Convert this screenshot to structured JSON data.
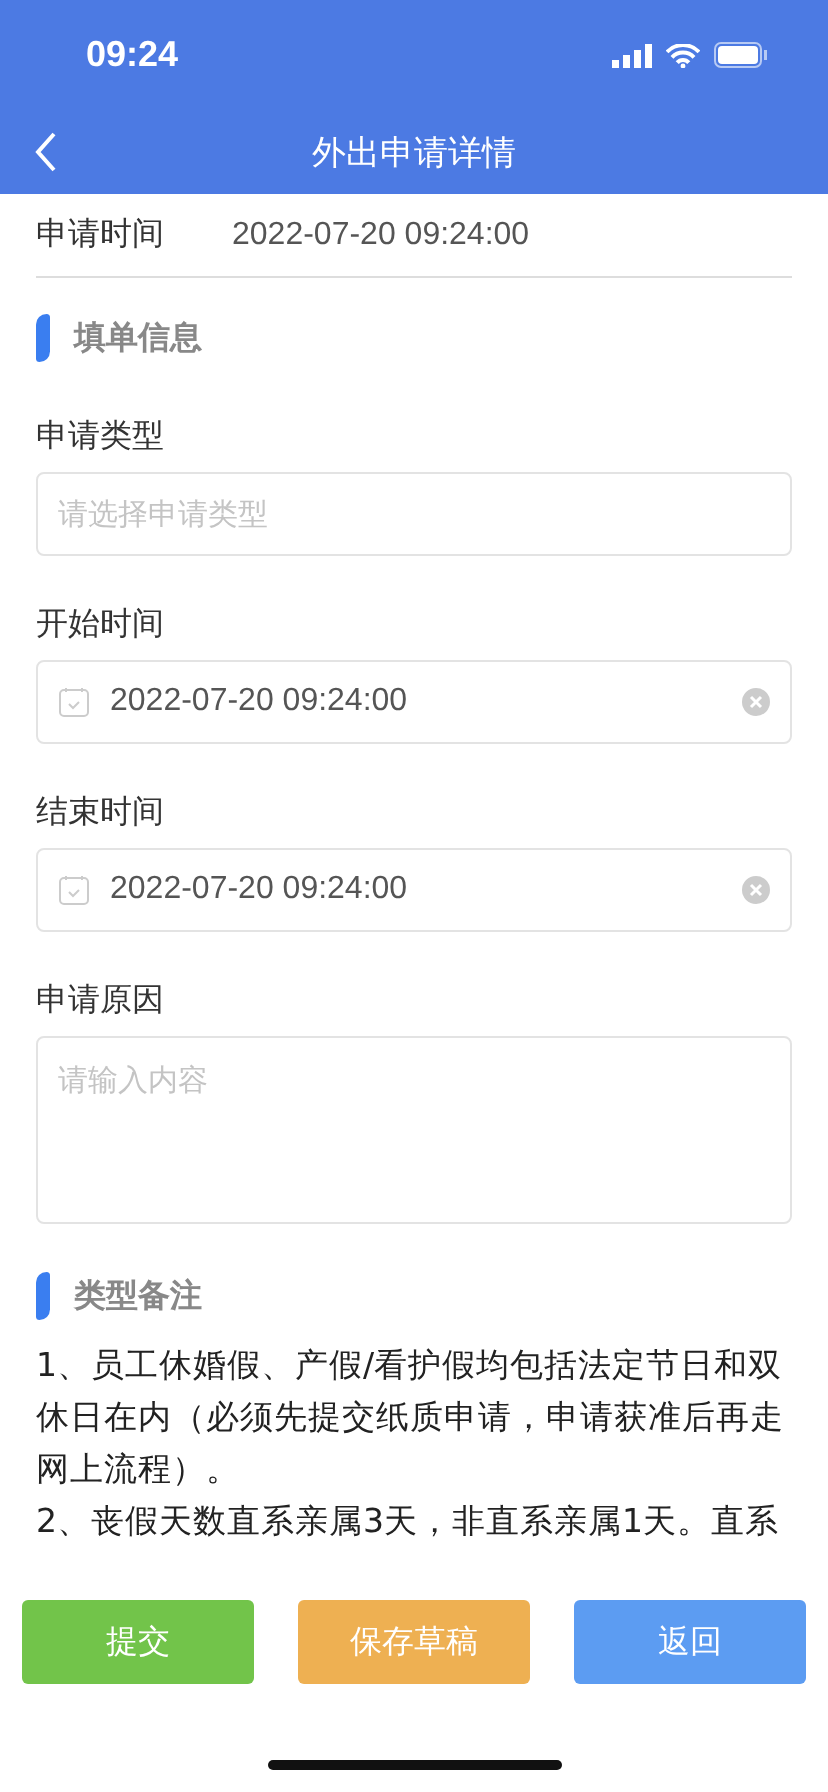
{
  "status_bar": {
    "time": "09:24"
  },
  "nav": {
    "title": "外出申请详情"
  },
  "apply_time": {
    "label": "申请时间",
    "value": "2022-07-20 09:24:00"
  },
  "form_section": {
    "title": "填单信息"
  },
  "fields": [
    {
      "kind": "select",
      "label": "申请类型",
      "placeholder": "请选择申请类型"
    },
    {
      "kind": "datetime",
      "label": "开始时间",
      "value": "2022-07-20 09:24:00"
    },
    {
      "kind": "datetime",
      "label": "结束时间",
      "value": "2022-07-20 09:24:00"
    },
    {
      "kind": "textarea",
      "label": "申请原因",
      "placeholder": "请输入内容"
    }
  ],
  "notes_section": {
    "title": "类型备注",
    "paragraphs": [
      "1、员工休婚假、产假/看护假均包括法定节日和双休日在内（必须先提交纸质申请，申请获准后再走网上流程）。",
      "2、丧假天数直系亲属3天，非直系亲属1天。直系"
    ]
  },
  "buttons": [
    {
      "label": "提交",
      "color": "#72c44a"
    },
    {
      "label": "保存草稿",
      "color": "#eeb052"
    },
    {
      "label": "返回",
      "color": "#5c9cf2"
    }
  ]
}
